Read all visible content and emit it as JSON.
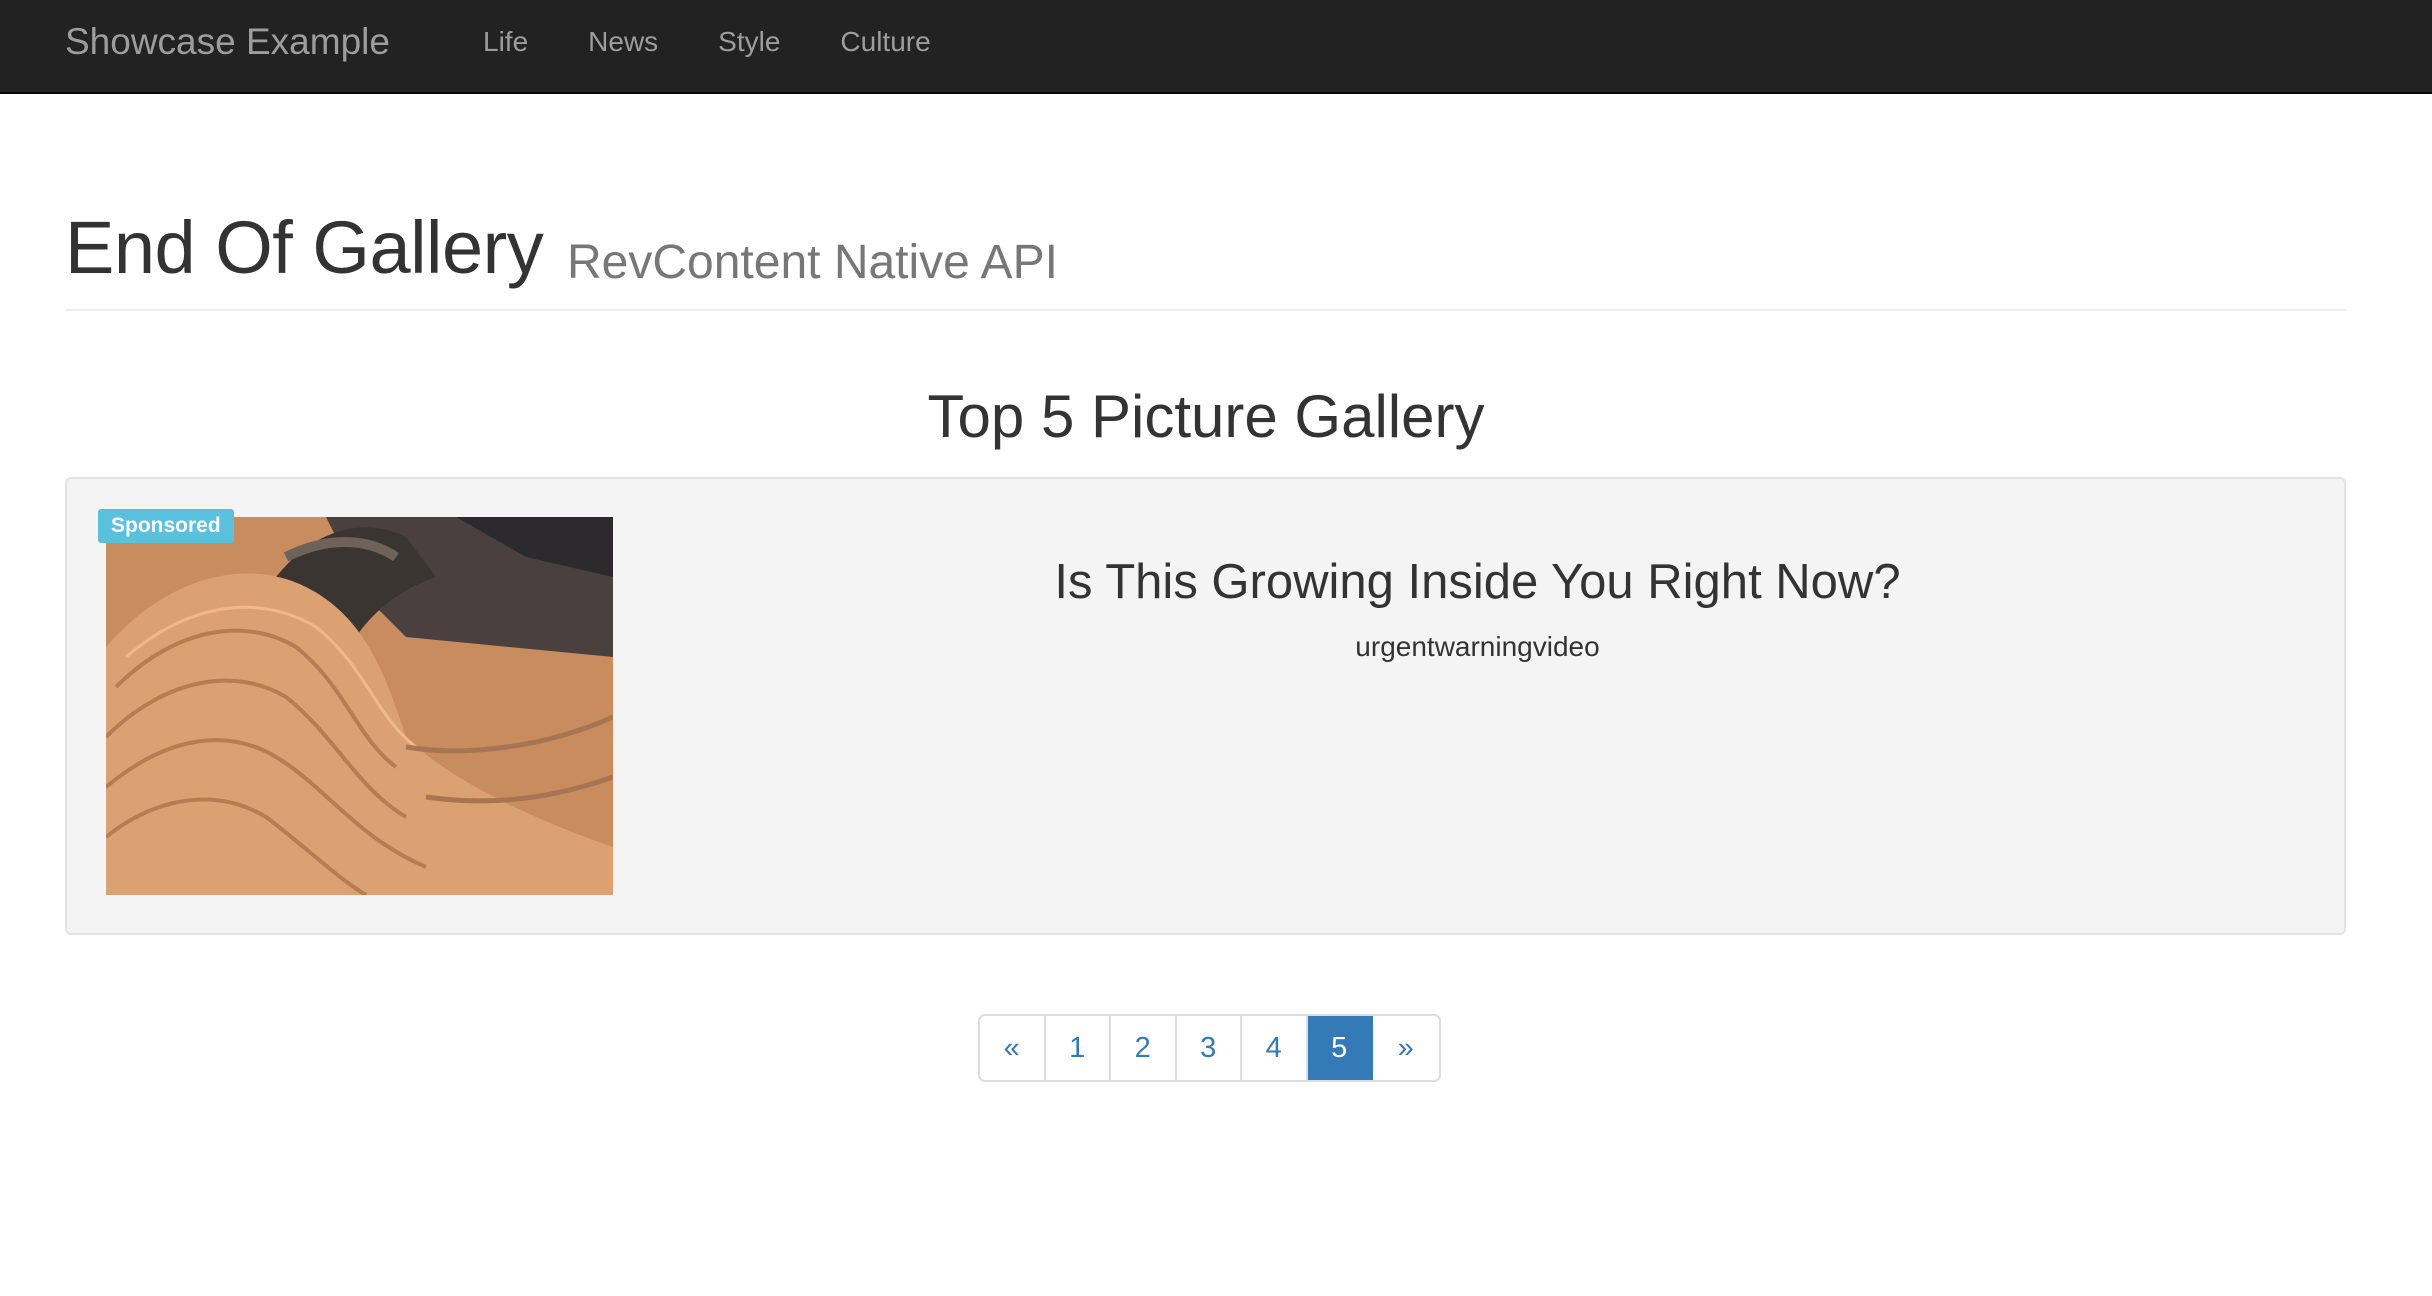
{
  "navbar": {
    "brand": "Showcase Example",
    "items": [
      "Life",
      "News",
      "Style",
      "Culture"
    ]
  },
  "header": {
    "title": "End Of Gallery",
    "subtitle": "RevContent Native API"
  },
  "gallery": {
    "title": "Top 5 Picture Gallery",
    "card": {
      "badge": "Sponsored",
      "headline": "Is This Growing Inside You Right Now?",
      "source": "urgentwarningvideo"
    }
  },
  "pagination": {
    "prev": "«",
    "pages": [
      "1",
      "2",
      "3",
      "4",
      "5"
    ],
    "next": "»",
    "active_page": "5"
  },
  "colors": {
    "navbar_bg": "#222222",
    "accent": "#337ab7",
    "badge": "#5bc0de",
    "card_bg": "#f4f4f4"
  }
}
